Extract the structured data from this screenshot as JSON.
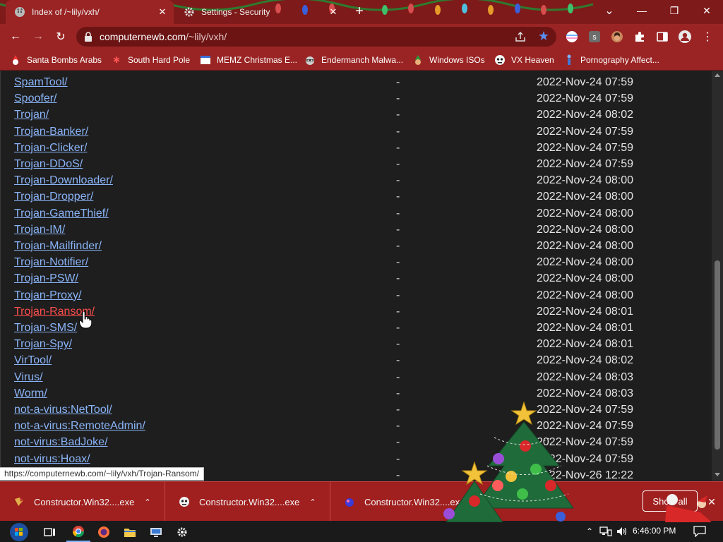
{
  "browser": {
    "tabs": [
      {
        "label": "Index of /~lily/vxh/",
        "icon": "wolf-favicon",
        "active": true
      },
      {
        "label": "Settings - Security",
        "icon": "gear-icon",
        "active": false
      }
    ],
    "address": {
      "host": "computernewb.com",
      "path": "/~lily/vxh/"
    },
    "window_controls": {
      "minimize": "—",
      "restore": "❐",
      "close": "✕",
      "tab_search": "⌄"
    }
  },
  "bookmarks": [
    {
      "label": "Santa Bombs Arabs",
      "icon": "santa-icon"
    },
    {
      "label": "South Hard Pole",
      "icon": "snowflake-icon"
    },
    {
      "label": "MEMZ Christmas E...",
      "icon": "window-icon"
    },
    {
      "label": "Endermanch Malwa...",
      "icon": "raccoon-icon"
    },
    {
      "label": "Windows ISOs",
      "icon": "elf-icon"
    },
    {
      "label": "VX Heaven",
      "icon": "pirate-icon"
    },
    {
      "label": "Pornography Affect...",
      "icon": "figure-icon"
    }
  ],
  "listing": {
    "rows": [
      {
        "name": "SpamTool/",
        "size": "-",
        "date": "2022-Nov-24 07:59"
      },
      {
        "name": "Spoofer/",
        "size": "-",
        "date": "2022-Nov-24 07:59"
      },
      {
        "name": "Trojan/",
        "size": "-",
        "date": "2022-Nov-24 08:02"
      },
      {
        "name": "Trojan-Banker/",
        "size": "-",
        "date": "2022-Nov-24 07:59"
      },
      {
        "name": "Trojan-Clicker/",
        "size": "-",
        "date": "2022-Nov-24 07:59"
      },
      {
        "name": "Trojan-DDoS/",
        "size": "-",
        "date": "2022-Nov-24 07:59"
      },
      {
        "name": "Trojan-Downloader/",
        "size": "-",
        "date": "2022-Nov-24 08:00"
      },
      {
        "name": "Trojan-Dropper/",
        "size": "-",
        "date": "2022-Nov-24 08:00"
      },
      {
        "name": "Trojan-GameThief/",
        "size": "-",
        "date": "2022-Nov-24 08:00"
      },
      {
        "name": "Trojan-IM/",
        "size": "-",
        "date": "2022-Nov-24 08:00"
      },
      {
        "name": "Trojan-Mailfinder/",
        "size": "-",
        "date": "2022-Nov-24 08:00"
      },
      {
        "name": "Trojan-Notifier/",
        "size": "-",
        "date": "2022-Nov-24 08:00"
      },
      {
        "name": "Trojan-PSW/",
        "size": "-",
        "date": "2022-Nov-24 08:00"
      },
      {
        "name": "Trojan-Proxy/",
        "size": "-",
        "date": "2022-Nov-24 08:00"
      },
      {
        "name": "Trojan-Ransom/",
        "size": "-",
        "date": "2022-Nov-24 08:01",
        "hover": true
      },
      {
        "name": "Trojan-SMS/",
        "size": "-",
        "date": "2022-Nov-24 08:01"
      },
      {
        "name": "Trojan-Spy/",
        "size": "-",
        "date": "2022-Nov-24 08:01"
      },
      {
        "name": "VirTool/",
        "size": "-",
        "date": "2022-Nov-24 08:02"
      },
      {
        "name": "Virus/",
        "size": "-",
        "date": "2022-Nov-24 08:03"
      },
      {
        "name": "Worm/",
        "size": "-",
        "date": "2022-Nov-24 08:03"
      },
      {
        "name": "not-a-virus:NetTool/",
        "size": "-",
        "date": "2022-Nov-24 07:59"
      },
      {
        "name": "not-a-virus:RemoteAdmin/",
        "size": "-",
        "date": "2022-Nov-24 07:59"
      },
      {
        "name": "not-virus:BadJoke/",
        "size": "-",
        "date": "2022-Nov-24 07:59"
      },
      {
        "name": "not-virus:Hoax/",
        "size": "-",
        "date": "2022-Nov-24 07:59"
      },
      {
        "name": "",
        "size": "-",
        "date": "2022-Nov-26 12:22"
      }
    ]
  },
  "status_url": "https://computernewb.com/~lily/vxh/Trojan-Ransom/",
  "downloads": {
    "items": [
      {
        "name": "Constructor.Win32....exe",
        "icon": "exe-file-icon"
      },
      {
        "name": "Constructor.Win32....exe",
        "icon": "pirate-file-icon"
      },
      {
        "name": "Constructor.Win32....exe",
        "icon": "orb-file-icon"
      }
    ],
    "show_all": "Show all"
  },
  "taskbar": {
    "clock": "6:46:00 PM",
    "apps": [
      "start-orb-icon",
      "task-view-icon",
      "chrome-icon",
      "firefox-icon",
      "file-explorer-icon",
      "computer-icon",
      "settings-gear-icon"
    ]
  },
  "colors": {
    "chrome_frame": "#9a2424",
    "tabstrip": "#7e1a1a",
    "page_bg": "#1e1e1e",
    "link": "#8ab4f8",
    "link_hover": "#ff4d4d",
    "shelf": "#a01f1f"
  }
}
